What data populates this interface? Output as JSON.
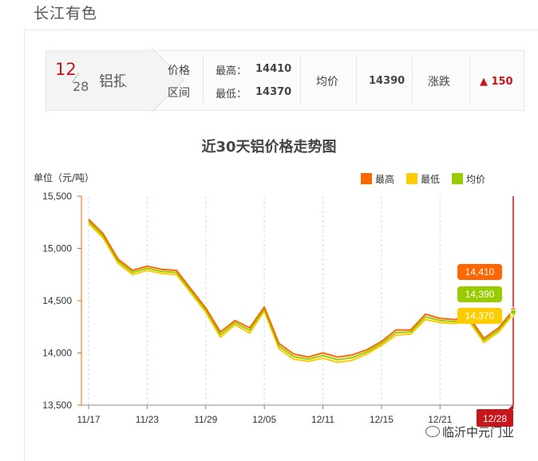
{
  "site": {
    "title": "长江有色"
  },
  "price_bar": {
    "date_month": "12",
    "date_day": "28",
    "metal_label": "铝报价",
    "range_label_1": "价格",
    "range_label_2": "区间",
    "high_label": "最高：",
    "high_value": "14410",
    "low_label": "最低：",
    "low_value": "14370",
    "avg_label": "均价",
    "avg_value": "14390",
    "change_label": "涨跌",
    "change_arrow": "🠉",
    "change_value": "150",
    "up_color": "#c8141b"
  },
  "chart_data": {
    "type": "line",
    "title": "近30天铝价格走势图",
    "ylabel": "单位（元/吨）",
    "xlabel": "",
    "ylim": [
      13500,
      15500
    ],
    "yticks": [
      "15,500",
      "15,000",
      "14,500",
      "14,000",
      "13,500"
    ],
    "ytick_values": [
      15500,
      15000,
      14500,
      14000,
      13500
    ],
    "xtick_labels": [
      "11/17",
      "11/23",
      "11/29",
      "12/05",
      "12/11",
      "12/15",
      "12/21",
      "12/28"
    ],
    "xtick_index": [
      0,
      4,
      8,
      12,
      16,
      20,
      24,
      29
    ],
    "grid": "vertical-dashed",
    "legend_position": "top-right",
    "series": [
      {
        "name": "最高",
        "color": "#ff6600",
        "values": [
          15280,
          15140,
          14900,
          14790,
          14830,
          14800,
          14790,
          14610,
          14430,
          14200,
          14310,
          14240,
          14440,
          14090,
          13990,
          13960,
          14000,
          13960,
          13980,
          14030,
          14110,
          14220,
          14220,
          14370,
          14330,
          14320,
          14340,
          14140,
          14240,
          14410
        ]
      },
      {
        "name": "最低",
        "color": "#ffcc00",
        "values": [
          15240,
          15100,
          14860,
          14750,
          14790,
          14760,
          14750,
          14570,
          14390,
          14150,
          14270,
          14190,
          14400,
          14040,
          13940,
          13920,
          13950,
          13910,
          13930,
          13990,
          14070,
          14170,
          14180,
          14320,
          14290,
          14280,
          14300,
          14100,
          14200,
          14370
        ]
      },
      {
        "name": "均价",
        "color": "#99cc00",
        "values": [
          15260,
          15120,
          14880,
          14770,
          14810,
          14780,
          14770,
          14590,
          14410,
          14175,
          14290,
          14215,
          14420,
          14065,
          13965,
          13940,
          13975,
          13935,
          13955,
          14010,
          14090,
          14195,
          14200,
          14345,
          14310,
          14300,
          14320,
          14120,
          14220,
          14390
        ]
      }
    ],
    "end_labels": [
      {
        "text": "14,410",
        "color": "#ff6600"
      },
      {
        "text": "14,390",
        "color": "#99cc00"
      },
      {
        "text": "14,370",
        "color": "#ffcc00"
      }
    ],
    "crosshair_label": "12/28",
    "crosshair_color": "#c8141b"
  },
  "watermark": {
    "text": "临沂中元门业"
  }
}
